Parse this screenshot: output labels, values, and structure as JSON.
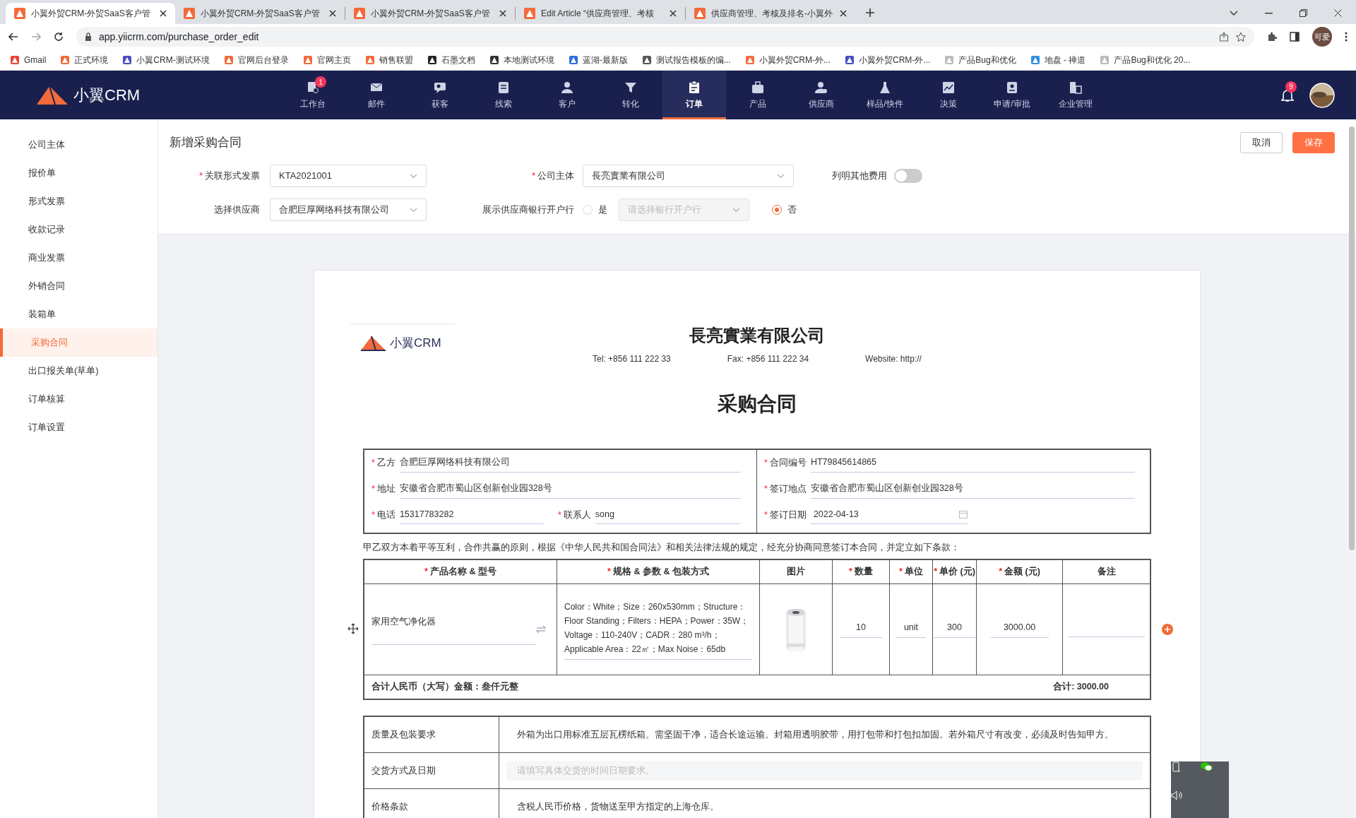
{
  "browser": {
    "tabs": [
      {
        "title": "小翼外贸CRM-外贸SaaS客户管",
        "selected": true
      },
      {
        "title": "小翼外贸CRM-外贸SaaS客户管",
        "selected": false
      },
      {
        "title": "小翼外贸CRM-外贸SaaS客户管",
        "selected": false
      },
      {
        "title": "Edit Article “供应商管理、考核",
        "selected": false
      },
      {
        "title": "供应商管理、考核及排名-小翼外",
        "selected": false
      }
    ],
    "url": "app.yiicrm.com/purchase_order_edit",
    "profile": "可爱",
    "bookmarks": [
      "Gmail",
      "正式环境",
      "小翼CRM-测试环境",
      "官网后台登录",
      "官网主页",
      "销售联盟",
      "石墨文档",
      "本地测试环境",
      "蓝湖-最新版",
      "测试报告模板的编...",
      "小翼外贸CRM-外...",
      "小翼外贸CRM-外...",
      "产品Bug和优化",
      "地盘 - 禅道",
      "产品Bug和优化 20..."
    ]
  },
  "app": {
    "logo": "小翼CRM",
    "nav": [
      {
        "label": "工作台",
        "badge": "1",
        "selected": false
      },
      {
        "label": "邮件",
        "selected": false
      },
      {
        "label": "获客",
        "selected": false
      },
      {
        "label": "线索",
        "selected": false
      },
      {
        "label": "客户",
        "selected": false
      },
      {
        "label": "转化",
        "selected": false
      },
      {
        "label": "订单",
        "selected": true
      },
      {
        "label": "产品",
        "selected": false
      },
      {
        "label": "供应商",
        "selected": false
      },
      {
        "label": "样品/快件",
        "selected": false
      },
      {
        "label": "决策",
        "selected": false
      },
      {
        "label": "申请/审批",
        "selected": false
      },
      {
        "label": "企业管理",
        "selected": false
      }
    ],
    "notifications": "9"
  },
  "sidebar": {
    "items": [
      {
        "label": "公司主体",
        "selected": false
      },
      {
        "label": "报价单",
        "selected": false
      },
      {
        "label": "形式发票",
        "selected": false
      },
      {
        "label": "收款记录",
        "selected": false
      },
      {
        "label": "商业发票",
        "selected": false
      },
      {
        "label": "外销合同",
        "selected": false
      },
      {
        "label": "装箱单",
        "selected": false
      },
      {
        "label": "采购合同",
        "selected": true
      },
      {
        "label": "出口报关单(草单)",
        "selected": false
      },
      {
        "label": "订单核算",
        "selected": false
      },
      {
        "label": "订单设置",
        "selected": false
      }
    ]
  },
  "header": {
    "title": "新增采购合同",
    "buttons": [
      {
        "label": "取消",
        "kind": "default"
      },
      {
        "label": "保存",
        "kind": "primary"
      }
    ],
    "form": {
      "invoice": {
        "label": "关联形式发票",
        "required_mark": "*",
        "value": "KTA2021001"
      },
      "entity": {
        "label": "公司主体",
        "required_mark": "*",
        "value": "長亮實業有限公司"
      },
      "other_fees": {
        "label": "列明其他费用",
        "on": false
      },
      "supplier": {
        "label": "选择供应商",
        "value": "合肥巨厚网络科技有限公司"
      },
      "show_bank": {
        "label": "展示供应商银行开户行",
        "options": [
          {
            "label": "是",
            "selected": false
          },
          {
            "label": "否",
            "selected": true
          }
        ],
        "bank_placeholder": "请选择银行开户行"
      }
    }
  },
  "document": {
    "logo": "小翼CRM",
    "company": "長亮實業有限公司",
    "tel": "Tel: +856 111 222 33",
    "fax": "Fax: +856 111 222 34",
    "website": "Website: http://",
    "title": "采购合同",
    "info_left": [
      {
        "required_mark": "*",
        "label": "乙方",
        "value": "合肥巨厚网络科技有限公司"
      },
      {
        "required_mark": "*",
        "label": "地址",
        "value": "安徽省合肥市蜀山区创新创业园328号"
      },
      {
        "required_mark": "*",
        "label": "电话",
        "value": "15317783282"
      },
      {
        "required_mark": "*",
        "label": "联系人",
        "value": "song"
      }
    ],
    "info_right": [
      {
        "required_mark": "*",
        "label": "合同编号",
        "value": "HT79845614865"
      },
      {
        "required_mark": "*",
        "label": "签订地点",
        "value": "安徽省合肥市蜀山区创新创业园328号"
      },
      {
        "required_mark": "*",
        "label": "签订日期",
        "value": "2022-04-13"
      }
    ],
    "intro": "甲乙双方本着平等互利，合作共赢的原则，根据《中华人民共和国合同法》和相关法律法规的规定，经充分协商同意签订本合同，并定立如下条款：",
    "table": {
      "columns": [
        {
          "required_mark": "*",
          "label": "产品名称 & 型号"
        },
        {
          "required_mark": "*",
          "label": "规格 & 参数 & 包装方式"
        },
        {
          "label": "图片"
        },
        {
          "required_mark": "*",
          "label": "数量"
        },
        {
          "required_mark": "*",
          "label": "单位"
        },
        {
          "required_mark": "*",
          "label": "单价 (元)"
        },
        {
          "required_mark": "*",
          "label": "金额 (元)"
        },
        {
          "label": "备注"
        }
      ],
      "rows": [
        {
          "product": "家用空气净化器",
          "spec": "Color：White；Size：260x530mm；Structure：Floor Standing；Filters：HEPA；Power：35W；Voltage：110-240V；CADR：280 m³/h；Applicable Area：22㎡；Max Noise：65db",
          "quantity": "10",
          "unit": "unit",
          "price": "300",
          "amount": "3000.00"
        }
      ],
      "total_words": "合计人民币（大写）金额：叁仟元整",
      "total": "合计: 3000.00"
    },
    "terms": [
      {
        "label": "质量及包装要求",
        "value": "外箱为出口用标准五层瓦楞纸箱。需坚固干净，适合长途运输。封箱用透明胶带，用打包带和打包扣加固。若外箱尺寸有改变，必须及时告知甲方。"
      },
      {
        "label": "交货方式及日期",
        "placeholder": "请填写具体交货的时间日期要求。"
      },
      {
        "label": "价格条款",
        "value": "含税人民币价格，货物送至甲方指定的上海仓库。"
      }
    ]
  }
}
